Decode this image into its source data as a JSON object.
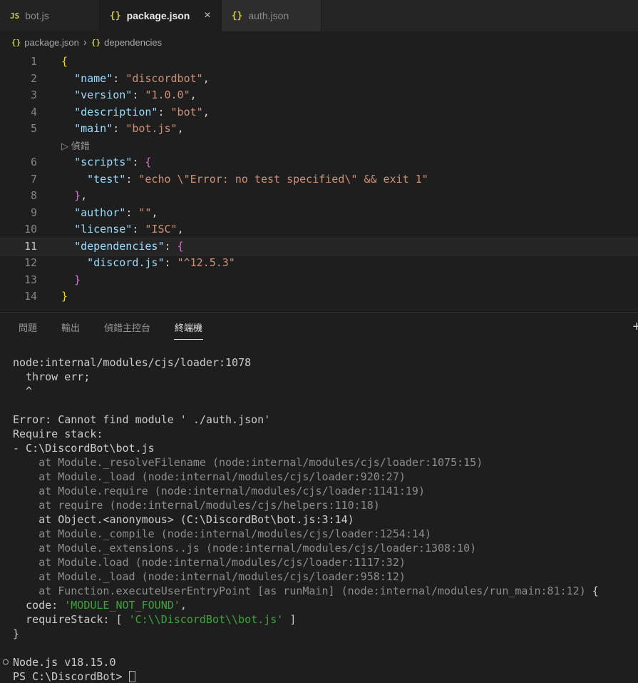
{
  "window": {
    "tabs": [
      {
        "icon": "js",
        "label": "bot.js",
        "active": false
      },
      {
        "icon": "json",
        "label": "package.json",
        "active": true,
        "close": "×"
      },
      {
        "icon": "json",
        "label": "auth.json",
        "active": false
      }
    ],
    "breadcrumb_separator": "›",
    "breadcrumb": [
      {
        "icon": "json",
        "label": "package.json"
      },
      {
        "icon": "json",
        "label": "dependencies"
      }
    ]
  },
  "editor": {
    "lines": [
      {
        "num": "1",
        "tokens": [
          {
            "t": "{",
            "c": "b1"
          }
        ]
      },
      {
        "num": "2",
        "tokens": [
          {
            "t": "  ",
            "c": "p"
          },
          {
            "t": "\"name\"",
            "c": "k"
          },
          {
            "t": ": ",
            "c": "p"
          },
          {
            "t": "\"discordbot\"",
            "c": "s"
          },
          {
            "t": ",",
            "c": "p"
          }
        ]
      },
      {
        "num": "3",
        "tokens": [
          {
            "t": "  ",
            "c": "p"
          },
          {
            "t": "\"version\"",
            "c": "k"
          },
          {
            "t": ": ",
            "c": "p"
          },
          {
            "t": "\"1.0.0\"",
            "c": "s"
          },
          {
            "t": ",",
            "c": "p"
          }
        ]
      },
      {
        "num": "4",
        "tokens": [
          {
            "t": "  ",
            "c": "p"
          },
          {
            "t": "\"description\"",
            "c": "k"
          },
          {
            "t": ": ",
            "c": "p"
          },
          {
            "t": "\"bot\"",
            "c": "s"
          },
          {
            "t": ",",
            "c": "p"
          }
        ]
      },
      {
        "num": "5",
        "tokens": [
          {
            "t": "  ",
            "c": "p"
          },
          {
            "t": "\"main\"",
            "c": "k"
          },
          {
            "t": ": ",
            "c": "p"
          },
          {
            "t": "\"bot.js\"",
            "c": "s"
          },
          {
            "t": ",",
            "c": "p"
          }
        ]
      },
      {
        "num": "",
        "lens": true,
        "tokens": [
          {
            "t": "▷ 偵錯",
            "c": "lens"
          }
        ]
      },
      {
        "num": "6",
        "tokens": [
          {
            "t": "  ",
            "c": "p"
          },
          {
            "t": "\"scripts\"",
            "c": "k"
          },
          {
            "t": ": ",
            "c": "p"
          },
          {
            "t": "{",
            "c": "b2"
          }
        ]
      },
      {
        "num": "7",
        "tokens": [
          {
            "t": "    ",
            "c": "p"
          },
          {
            "t": "\"test\"",
            "c": "k"
          },
          {
            "t": ": ",
            "c": "p"
          },
          {
            "t": "\"echo \\\"Error: no test specified\\\" && exit 1\"",
            "c": "s"
          }
        ]
      },
      {
        "num": "8",
        "tokens": [
          {
            "t": "  ",
            "c": "p"
          },
          {
            "t": "}",
            "c": "b2"
          },
          {
            "t": ",",
            "c": "p"
          }
        ]
      },
      {
        "num": "9",
        "tokens": [
          {
            "t": "  ",
            "c": "p"
          },
          {
            "t": "\"author\"",
            "c": "k"
          },
          {
            "t": ": ",
            "c": "p"
          },
          {
            "t": "\"\"",
            "c": "s"
          },
          {
            "t": ",",
            "c": "p"
          }
        ]
      },
      {
        "num": "10",
        "tokens": [
          {
            "t": "  ",
            "c": "p"
          },
          {
            "t": "\"license\"",
            "c": "k"
          },
          {
            "t": ": ",
            "c": "p"
          },
          {
            "t": "\"ISC\"",
            "c": "s"
          },
          {
            "t": ",",
            "c": "p"
          }
        ]
      },
      {
        "num": "11",
        "current": true,
        "tokens": [
          {
            "t": "  ",
            "c": "p"
          },
          {
            "t": "\"dependencies\"",
            "c": "k"
          },
          {
            "t": ": ",
            "c": "p"
          },
          {
            "t": "{",
            "c": "b2"
          }
        ]
      },
      {
        "num": "12",
        "tokens": [
          {
            "t": "    ",
            "c": "p"
          },
          {
            "t": "\"discord.js\"",
            "c": "k"
          },
          {
            "t": ": ",
            "c": "p"
          },
          {
            "t": "\"^12.5.3\"",
            "c": "s"
          }
        ]
      },
      {
        "num": "13",
        "tokens": [
          {
            "t": "  ",
            "c": "p"
          },
          {
            "t": "}",
            "c": "b2"
          }
        ]
      },
      {
        "num": "14",
        "tokens": [
          {
            "t": "}",
            "c": "b1"
          }
        ]
      }
    ]
  },
  "panel": {
    "tabs": [
      {
        "label": "問題",
        "active": false
      },
      {
        "label": "輸出",
        "active": false
      },
      {
        "label": "偵錯主控台",
        "active": false
      },
      {
        "label": "終端機",
        "active": true
      }
    ],
    "new_terminal_label": "+"
  },
  "terminal": {
    "lines": [
      {
        "tokens": [
          {
            "t": "node:internal/modules/cjs/loader:1078",
            "c": "fg"
          }
        ]
      },
      {
        "tokens": [
          {
            "t": "  throw err;",
            "c": "fg"
          }
        ]
      },
      {
        "tokens": [
          {
            "t": "  ^",
            "c": "fg"
          }
        ]
      },
      {
        "tokens": []
      },
      {
        "tokens": [
          {
            "t": "Error: Cannot find module ' ./auth.json'",
            "c": "fg"
          }
        ]
      },
      {
        "tokens": [
          {
            "t": "Require stack:",
            "c": "fg"
          }
        ]
      },
      {
        "tokens": [
          {
            "t": "- C:\\DiscordBot\\bot.js",
            "c": "fg"
          }
        ]
      },
      {
        "tokens": [
          {
            "t": "    at Module._resolveFilename (node:internal/modules/cjs/loader:1075:15)",
            "c": "dim"
          }
        ]
      },
      {
        "tokens": [
          {
            "t": "    at Module._load (node:internal/modules/cjs/loader:920:27)",
            "c": "dim"
          }
        ]
      },
      {
        "tokens": [
          {
            "t": "    at Module.require (node:internal/modules/cjs/loader:1141:19)",
            "c": "dim"
          }
        ]
      },
      {
        "tokens": [
          {
            "t": "    at require (node:internal/modules/cjs/helpers:110:18)",
            "c": "dim"
          }
        ]
      },
      {
        "tokens": [
          {
            "t": "    at Object.<anonymous> (C:\\DiscordBot\\bot.js:3:14)",
            "c": "fg"
          }
        ]
      },
      {
        "tokens": [
          {
            "t": "    at Module._compile (node:internal/modules/cjs/loader:1254:14)",
            "c": "dim"
          }
        ]
      },
      {
        "tokens": [
          {
            "t": "    at Module._extensions..js (node:internal/modules/cjs/loader:1308:10)",
            "c": "dim"
          }
        ]
      },
      {
        "tokens": [
          {
            "t": "    at Module.load (node:internal/modules/cjs/loader:1117:32)",
            "c": "dim"
          }
        ]
      },
      {
        "tokens": [
          {
            "t": "    at Module._load (node:internal/modules/cjs/loader:958:12)",
            "c": "dim"
          }
        ]
      },
      {
        "tokens": [
          {
            "t": "    at Function.executeUserEntryPoint [as runMain] (node:internal/modules/run_main:81:12) ",
            "c": "dim"
          },
          {
            "t": "{",
            "c": "fg"
          }
        ]
      },
      {
        "tokens": [
          {
            "t": "  code: ",
            "c": "fg"
          },
          {
            "t": "'MODULE_NOT_FOUND'",
            "c": "grn"
          },
          {
            "t": ",",
            "c": "fg"
          }
        ]
      },
      {
        "tokens": [
          {
            "t": "  requireStack: [ ",
            "c": "fg"
          },
          {
            "t": "'C:\\\\DiscordBot\\\\bot.js'",
            "c": "grn"
          },
          {
            "t": " ]",
            "c": "fg"
          }
        ]
      },
      {
        "tokens": [
          {
            "t": "}",
            "c": "fg"
          }
        ]
      },
      {
        "tokens": []
      },
      {
        "tokens": [
          {
            "t": "○",
            "c": "deco"
          },
          {
            "t": "Node.js v18.15.0",
            "c": "fg"
          }
        ]
      },
      {
        "tokens": [
          {
            "t": "PS C:\\DiscordBot> ",
            "c": "fg"
          },
          {
            "t": "",
            "c": "cursor"
          }
        ]
      }
    ]
  },
  "colors": {
    "editor_background": "#1e1e1e",
    "tab_bar_background": "#252526",
    "json_key": "#9cdcfe",
    "json_string": "#ce9178",
    "bracket_level1": "#ffd700",
    "bracket_level2": "#da70d6",
    "terminal_foreground": "#cccccc",
    "terminal_dim": "#8c8c8c",
    "terminal_green": "#3fa33d",
    "file_icon_yellow": "#cbcb41"
  }
}
